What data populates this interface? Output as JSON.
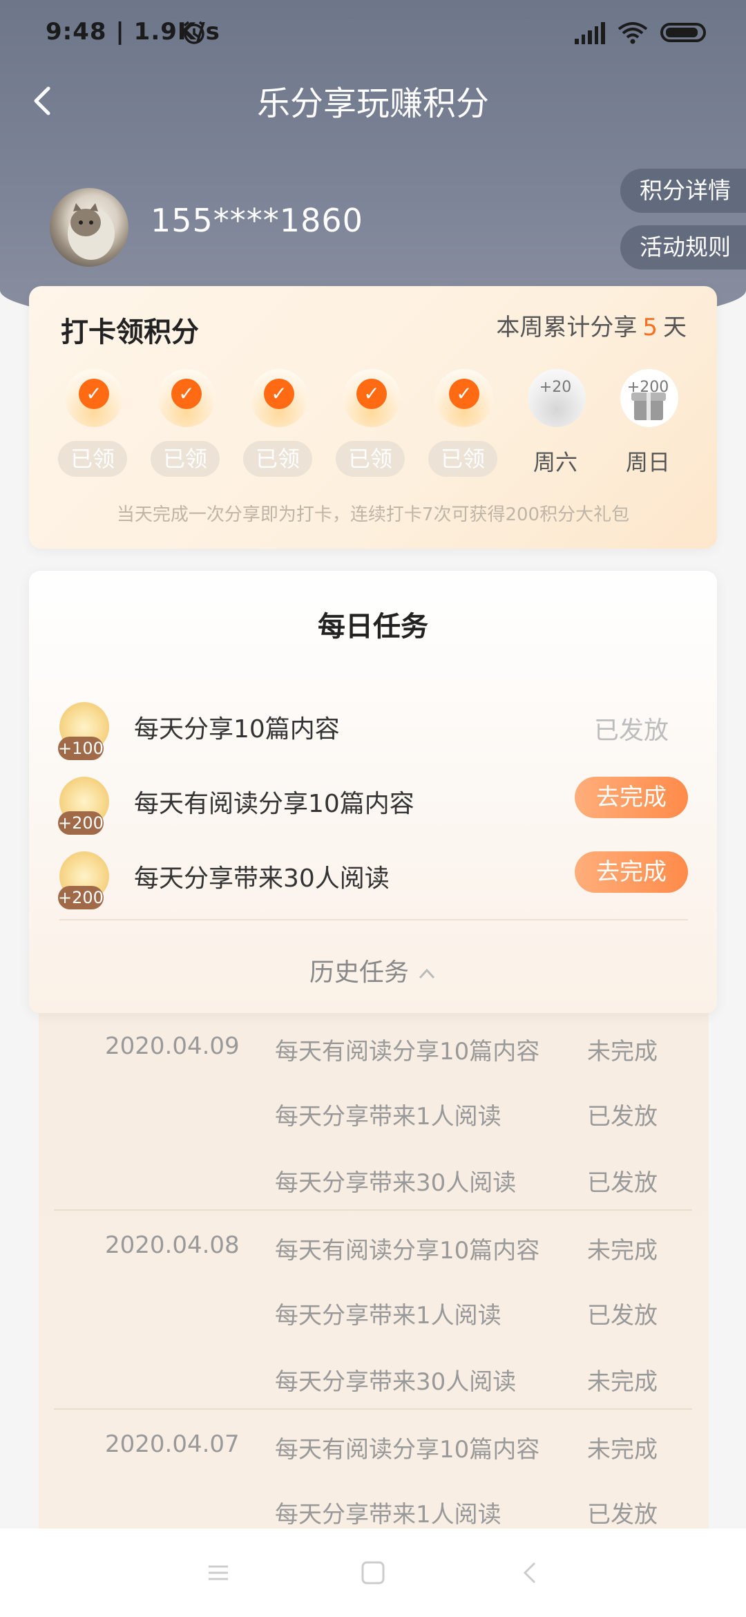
{
  "status_bar": {
    "time": "9:48 | 1.9K/s",
    "alarm_icon": "alarm-icon",
    "signal_icon": "signal-hd-icon",
    "wifi_icon": "wifi-icon",
    "battery_icon": "battery-icon"
  },
  "nav": {
    "back_icon": "chevron-left-icon",
    "title": "乐分享玩赚积分"
  },
  "profile": {
    "username": "155****1860",
    "points_detail_label": "积分详情",
    "rules_label": "活动规则"
  },
  "checkin": {
    "title": "打卡领积分",
    "week_prefix": "本周累计分享",
    "week_days": "5",
    "week_suffix": "天",
    "days": [
      {
        "state": "claimed",
        "label": "已领"
      },
      {
        "state": "claimed",
        "label": "已领"
      },
      {
        "state": "claimed",
        "label": "已领"
      },
      {
        "state": "claimed",
        "label": "已领"
      },
      {
        "state": "claimed",
        "label": "已领"
      },
      {
        "state": "upcoming",
        "bonus": "+20",
        "label": "周六"
      },
      {
        "state": "gift",
        "bonus": "+200",
        "label": "周日"
      }
    ],
    "note": "当天完成一次分享即为打卡，连续打卡7次可获得200积分大礼包"
  },
  "daily_tasks": {
    "title": "每日任务",
    "items": [
      {
        "points": "+100",
        "name": "每天分享10篇内容",
        "status": "已发放",
        "action": null
      },
      {
        "points": "+200",
        "name": "每天有阅读分享10篇内容",
        "status": null,
        "action": "去完成"
      },
      {
        "points": "+200",
        "name": "每天分享带来30人阅读",
        "status": null,
        "action": "去完成"
      }
    ],
    "history_label": "历史任务",
    "history_chevron": "chevron-up-icon"
  },
  "history": [
    {
      "date": "2020.04.09",
      "rows": [
        {
          "task": "每天有阅读分享10篇内容",
          "status": "未完成"
        },
        {
          "task": "每天分享带来1人阅读",
          "status": "已发放"
        },
        {
          "task": "每天分享带来30人阅读",
          "status": "已发放"
        }
      ]
    },
    {
      "date": "2020.04.08",
      "rows": [
        {
          "task": "每天有阅读分享10篇内容",
          "status": "未完成"
        },
        {
          "task": "每天分享带来1人阅读",
          "status": "已发放"
        },
        {
          "task": "每天分享带来30人阅读",
          "status": "未完成"
        }
      ]
    },
    {
      "date": "2020.04.07",
      "rows": [
        {
          "task": "每天有阅读分享10篇内容",
          "status": "未完成"
        },
        {
          "task": "每天分享带来1人阅读",
          "status": "已发放"
        }
      ]
    }
  ],
  "system_nav": {
    "menu_icon": "menu-icon",
    "home_icon": "home-square-icon",
    "back_icon": "back-triangle-icon"
  },
  "colors": {
    "header": "#737b8f",
    "accent": "#ff6a12",
    "button": "#ff8b4a"
  }
}
